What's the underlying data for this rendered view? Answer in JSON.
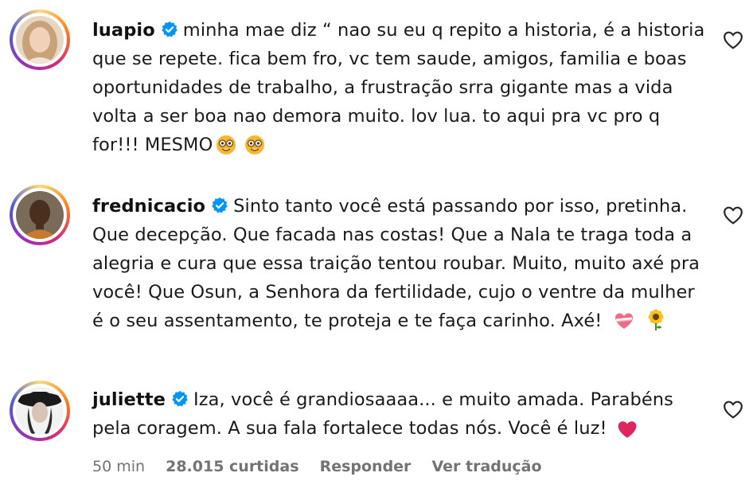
{
  "comments": [
    {
      "username": "luapio",
      "text": "minha mae diz “ nao su eu q repito a historia, é a historia que se repete. fica bem fro, vc tem saude, amigos, familia e boas oportunidades de trabalho, a frustração srra gigante mas a vida volta a ser boa nao demora muito. lov lua. to aqui pra vc pro q for!!! MESMO",
      "emojis": [
        "nerd-face-emoji",
        "nerd-face-emoji"
      ]
    },
    {
      "username": "frednicacio",
      "text": "Sinto tanto você está passando por isso, pretinha. Que decepção. Que facada nas costas! Que a Nala te traga toda a alegria e cura que essa traição tentou roubar. Muito, muito axé pra você! Que Osun, a Senhora da fertilidade, cujo o ventre da mulher é o seu assentamento, te proteja e te faça carinho. Axé!",
      "emojis": [
        "heart-with-ribbon-emoji",
        "sunflower-emoji"
      ]
    },
    {
      "username": "juliette",
      "text": "Iza, você é grandiosaaaa... e muito amada. Parabéns pela coragem. A sua fala fortalece todas nós. Você é luz!",
      "emojis": [
        "red-heart-emoji"
      ],
      "meta": {
        "time": "50 min",
        "likes": "28.015 curtidas",
        "reply": "Responder",
        "translate": "Ver tradução"
      }
    }
  ],
  "colors": {
    "verified": "#0095f6",
    "meta_text": "#737373",
    "red_heart": "#e0245e"
  }
}
